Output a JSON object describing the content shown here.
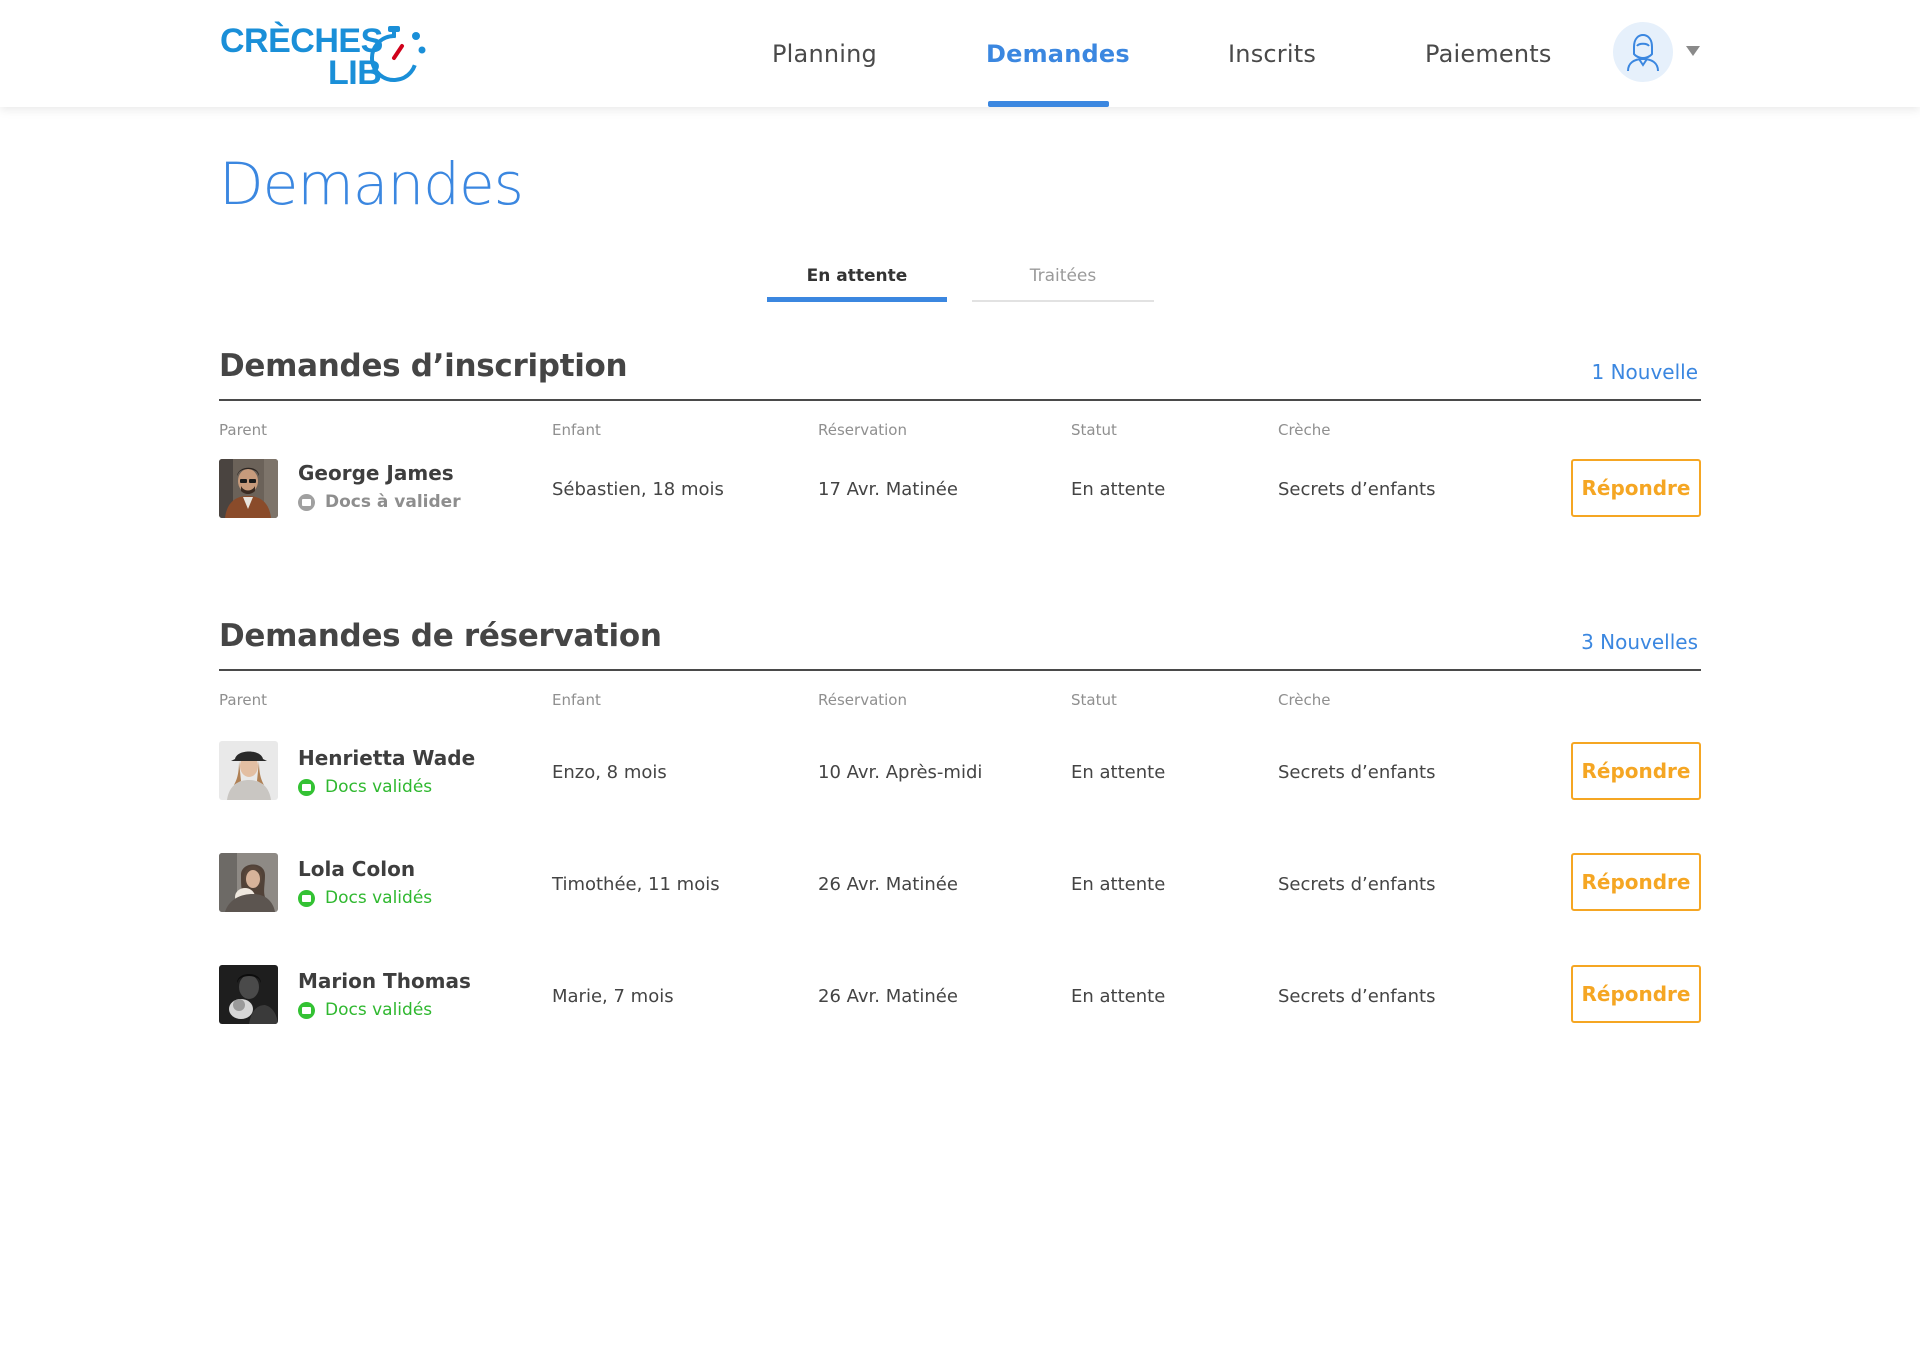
{
  "brand": {
    "line1": "CRÈCHES",
    "line2": "LIB",
    "color": "#1a8fd8",
    "accent": "#d0021b"
  },
  "nav": {
    "items": [
      {
        "label": "Planning",
        "active": false
      },
      {
        "label": "Demandes",
        "active": true
      },
      {
        "label": "Inscrits",
        "active": false
      },
      {
        "label": "Paiements",
        "active": false
      }
    ],
    "avatar_icon": "user-avatar-icon",
    "menu_icon": "caret-down-icon"
  },
  "page": {
    "title": "Demandes"
  },
  "tabs": [
    {
      "label": "En attente",
      "active": true
    },
    {
      "label": "Traitées",
      "active": false
    }
  ],
  "columns": {
    "parent": "Parent",
    "enfant": "Enfant",
    "reservation": "Réservation",
    "statut": "Statut",
    "creche": "Crèche"
  },
  "inscription": {
    "title": "Demandes d’inscription",
    "count": "1 Nouvelle",
    "rows": [
      {
        "parent": "George James",
        "docs": "Docs à valider",
        "docs_state": "pending",
        "enfant": "Sébastien, 18 mois",
        "reservation": "17 Avr. Matinée",
        "statut": "En attente",
        "creche": "Secrets d’enfants",
        "action": "Répondre"
      }
    ]
  },
  "reservation": {
    "title": "Demandes de réservation",
    "count": "3 Nouvelles",
    "rows": [
      {
        "parent": "Henrietta Wade",
        "docs": "Docs validés",
        "docs_state": "validated",
        "enfant": "Enzo, 8 mois",
        "reservation": "10 Avr. Après-midi",
        "statut": "En attente",
        "creche": "Secrets d’enfants",
        "action": "Répondre"
      },
      {
        "parent": "Lola Colon",
        "docs": "Docs validés",
        "docs_state": "validated",
        "enfant": "Timothée, 11 mois",
        "reservation": "26 Avr. Matinée",
        "statut": "En attente",
        "creche": "Secrets d’enfants",
        "action": "Répondre"
      },
      {
        "parent": "Marion Thomas",
        "docs": "Docs validés",
        "docs_state": "validated",
        "enfant": "Marie, 7 mois",
        "reservation": "26 Avr. Matinée",
        "statut": "En attente",
        "creche": "Secrets d’enfants",
        "action": "Répondre"
      }
    ]
  },
  "colors": {
    "primary": "#3b87e0",
    "action": "#f5a623",
    "validated": "#2fb82f",
    "pending": "#8e8e8e"
  }
}
